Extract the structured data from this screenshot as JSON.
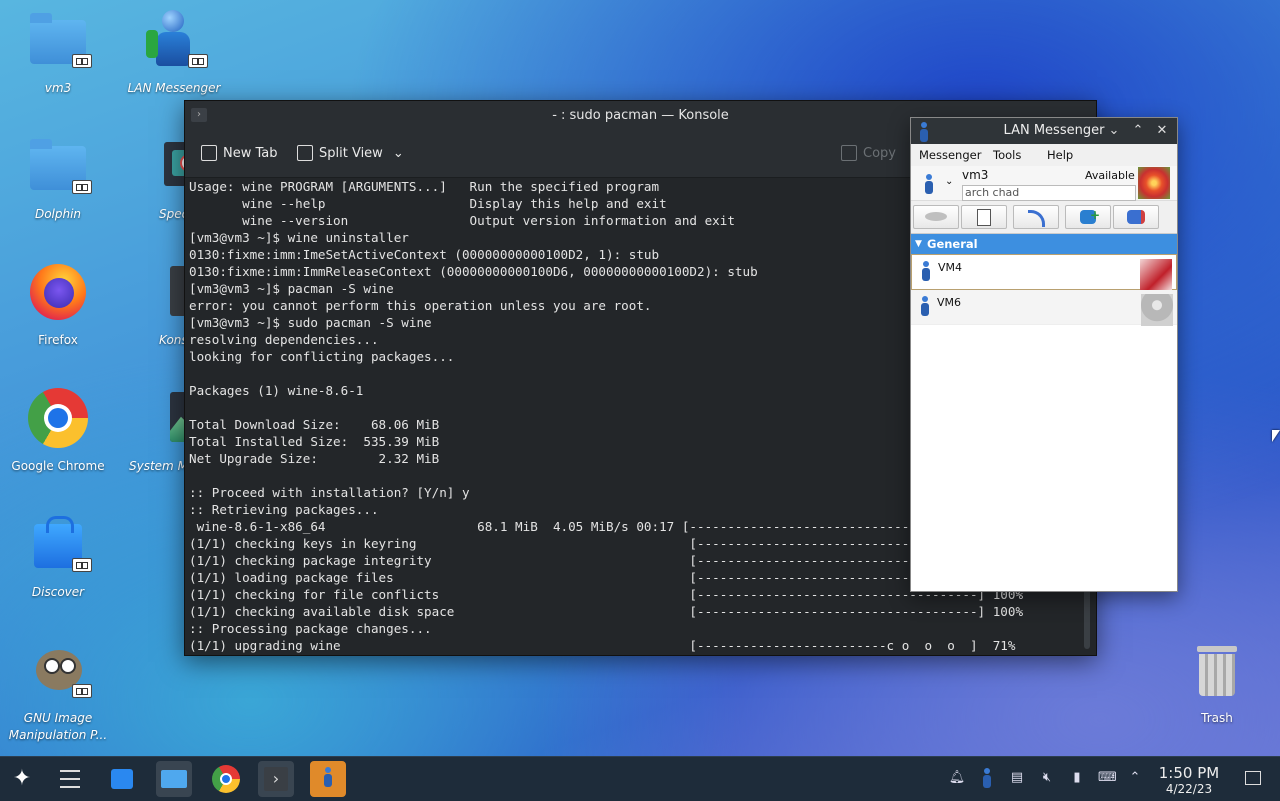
{
  "desktop": {
    "icons": [
      {
        "label": "vm3"
      },
      {
        "label": "LAN Messenger"
      },
      {
        "label": "Dolphin"
      },
      {
        "label": "Spect"
      },
      {
        "label": "Firefox"
      },
      {
        "label": "Konso"
      },
      {
        "label": "Google Chrome"
      },
      {
        "label": "System M"
      },
      {
        "label": "Discover"
      },
      {
        "label": "GNU Image Manipulation P..."
      },
      {
        "label": "Trash"
      }
    ]
  },
  "konsole": {
    "title": "- : sudo pacman — Konsole",
    "toolbar": {
      "new_tab": "New Tab",
      "split_view": "Split View",
      "copy": "Copy"
    },
    "lines": [
      "Usage: wine PROGRAM [ARGUMENTS...]   Run the specified program",
      "       wine --help                   Display this help and exit",
      "       wine --version                Output version information and exit",
      "[vm3@vm3 ~]$ wine uninstaller",
      "0130:fixme:imm:ImeSetActiveContext (00000000000100D2, 1): stub",
      "0130:fixme:imm:ImmReleaseContext (00000000000100D6, 00000000000100D2): stub",
      "[vm3@vm3 ~]$ pacman -S wine",
      "error: you cannot perform this operation unless you are root.",
      "[vm3@vm3 ~]$ sudo pacman -S wine",
      "resolving dependencies...",
      "looking for conflicting packages...",
      "",
      "Packages (1) wine-8.6-1",
      "",
      "Total Download Size:    68.06 MiB",
      "Total Installed Size:  535.39 MiB",
      "Net Upgrade Size:        2.32 MiB",
      "",
      ":: Proceed with installation? [Y/n] y",
      ":: Retrieving packages...",
      " wine-8.6-1-x86_64                    68.1 MiB  4.05 MiB/s 00:17 [-------------------------------------] 100%",
      "(1/1) checking keys in keyring                                    [-------------------------------------] 100%",
      "(1/1) checking package integrity                                  [-------------------------------------] 100%",
      "(1/1) loading package files                                       [-------------------------------------] 100%",
      "(1/1) checking for file conflicts                                 [-------------------------------------] 100%",
      "(1/1) checking available disk space                               [-------------------------------------] 100%",
      ":: Processing package changes...",
      "(1/1) upgrading wine                                              [-------------------------c o  o  o  ]  71%"
    ]
  },
  "lan": {
    "title": "LAN Messenger",
    "menu": [
      "Messenger",
      "Tools",
      "Help"
    ],
    "user": {
      "name": "vm3",
      "status": "Available",
      "status_message": "arch chad"
    },
    "group": "General",
    "contacts": [
      "VM4",
      "VM6"
    ]
  },
  "taskbar": {
    "time": "1:50 PM",
    "date": "4/22/23"
  }
}
